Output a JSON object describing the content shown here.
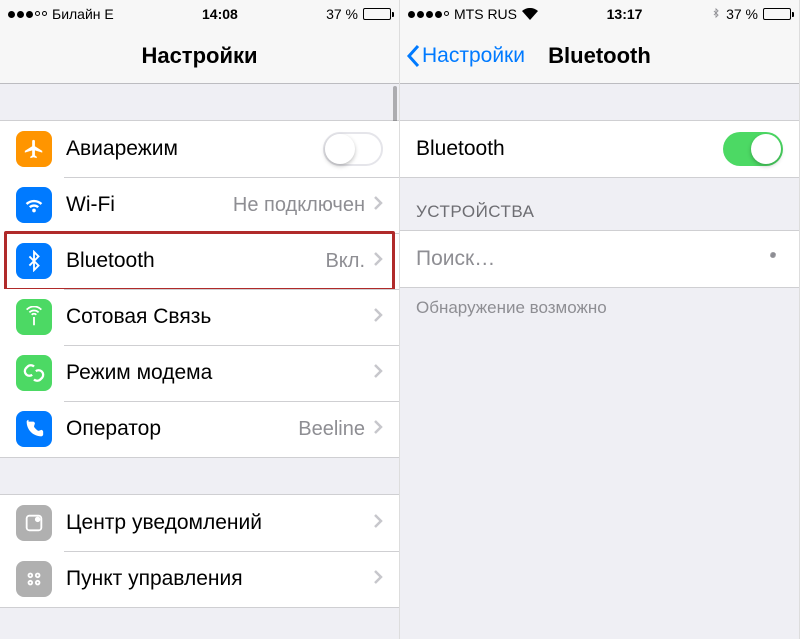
{
  "left": {
    "status": {
      "carrier": "Билайн  E",
      "time": "14:08",
      "battery_pct": "37 %"
    },
    "nav": {
      "title": "Настройки"
    },
    "rows": {
      "airplane": {
        "label": "Авиарежим"
      },
      "wifi": {
        "label": "Wi-Fi",
        "value": "Не подключен"
      },
      "bt": {
        "label": "Bluetooth",
        "value": "Вкл."
      },
      "cellular": {
        "label": "Сотовая Связь"
      },
      "hotspot": {
        "label": "Режим модема"
      },
      "carrier": {
        "label": "Оператор",
        "value": "Beeline"
      },
      "notif": {
        "label": "Центр уведомлений"
      },
      "control": {
        "label": "Пункт управления"
      }
    }
  },
  "right": {
    "status": {
      "carrier": "MTS RUS",
      "time": "13:17",
      "battery_pct": "37 %"
    },
    "nav": {
      "back": "Настройки",
      "title": "Bluetooth"
    },
    "toggle": {
      "label": "Bluetooth"
    },
    "devices_header": "УСТРОЙСТВА",
    "searching": "Поиск…",
    "footer": "Обнаружение возможно"
  },
  "colors": {
    "airplane": "#ff9500",
    "wifi": "#007aff",
    "bt": "#007aff",
    "cellular": "#4cd964",
    "hotspot": "#4cd964",
    "carrier": "#007aff",
    "notif": "#aaaaaa",
    "control": "#aaaaaa"
  }
}
